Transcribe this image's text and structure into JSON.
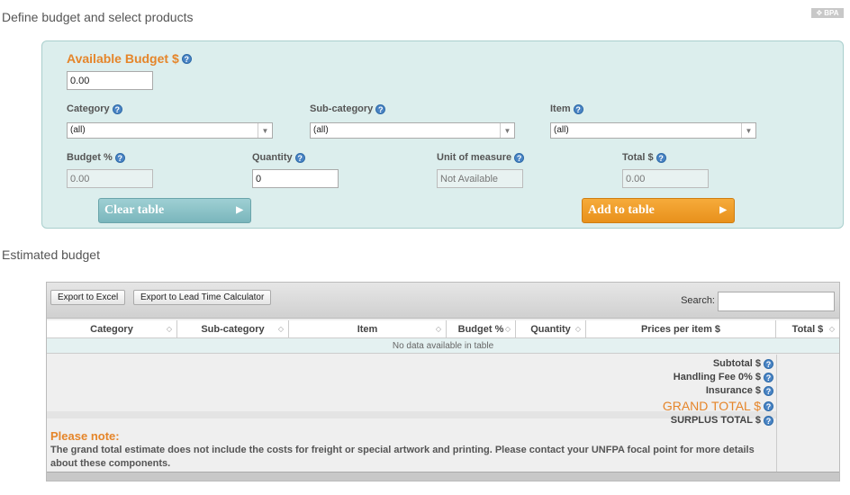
{
  "header": {
    "title": "Define budget and select products",
    "badge": "BPA"
  },
  "form": {
    "available_budget_label": "Available Budget $",
    "available_budget_value": "0.00",
    "category_label": "Category",
    "category_value": "(all)",
    "subcategory_label": "Sub-category",
    "subcategory_value": "(all)",
    "item_label": "Item",
    "item_value": "(all)",
    "budget_pct_label": "Budget %",
    "budget_pct_value": "0.00",
    "quantity_label": "Quantity",
    "quantity_value": "0",
    "uom_label": "Unit of measure",
    "uom_value": "Not Available",
    "total_label": "Total $",
    "total_value": "0.00",
    "clear_label": "Clear table",
    "add_label": "Add to table"
  },
  "estimated": {
    "title": "Estimated budget",
    "export_excel": "Export to Excel",
    "export_ltc": "Export to Lead Time Calculator",
    "search_label": "Search:",
    "columns": [
      "Category",
      "Sub-category",
      "Item",
      "Budget %",
      "Quantity",
      "Prices per item $",
      "Total $"
    ],
    "empty_text": "No data available in table",
    "subtotal": "Subtotal $",
    "handling": "Handling Fee 0% $",
    "insurance": "Insurance $",
    "grand_total": "GRAND TOTAL $",
    "surplus": "SURPLUS TOTAL $",
    "note_title": "Please note:",
    "note_body": "The grand total estimate does not include the costs for freight or special artwork and printing. Please contact your UNFPA focal point for more details about these components."
  },
  "colors": {
    "accent_orange": "#e5852a",
    "panel_bg": "#dceeed",
    "help_blue": "#4a84c4"
  },
  "icons": {
    "help": "question-circle-icon",
    "sort": "sort-arrows-icon",
    "dropdown": "chevron-down-icon"
  }
}
